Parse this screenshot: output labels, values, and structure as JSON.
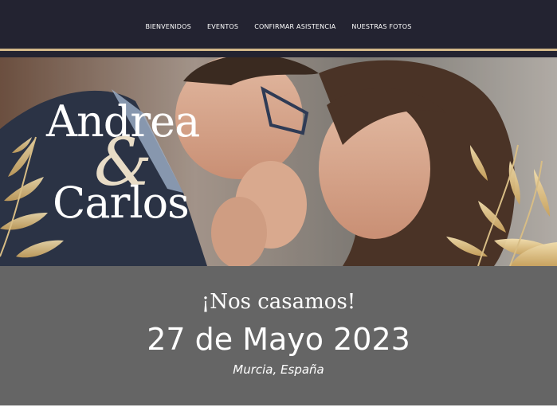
{
  "nav": {
    "items": [
      {
        "label": "BIENVENIDOS"
      },
      {
        "label": "EVENTOS"
      },
      {
        "label": "CONFIRMAR ASISTENCIA"
      },
      {
        "label": "NUESTRAS FOTOS"
      }
    ]
  },
  "hero": {
    "name_1": "Andrea",
    "ampersand": "&",
    "name_2": "Carlos"
  },
  "info": {
    "tagline": "¡Nos casamos!",
    "date": "27 de Mayo 2023",
    "location": "Murcia, España"
  },
  "colors": {
    "nav_background": "#232331",
    "accent_gold": "#d4b98a",
    "info_background": "#656565"
  }
}
